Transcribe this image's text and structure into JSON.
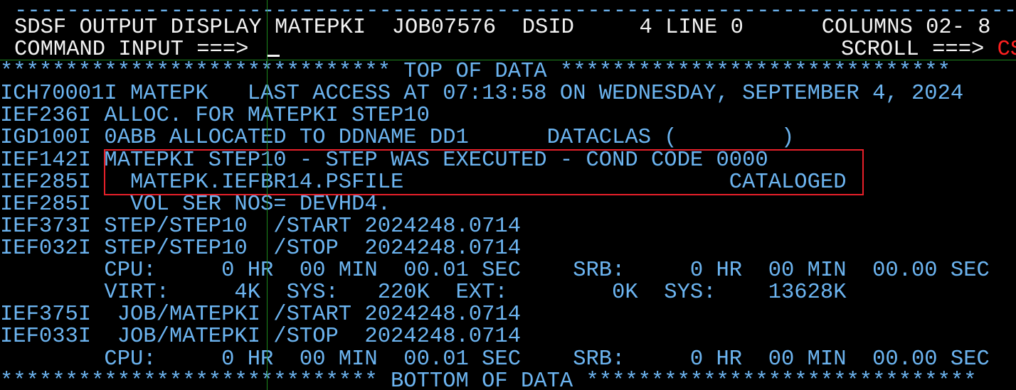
{
  "header": {
    "dashes": "-----------------------------------------------------------------------------",
    "title": "SDSF OUTPUT DISPLAY",
    "jobname": "MATEPKI",
    "jobid": "JOB07576",
    "dsid_label": "DSID",
    "dsid_value": "4",
    "line_label": "LINE",
    "line_value": "0",
    "columns_label": "COLUMNS",
    "columns_value": "02- 8",
    "command_label": "COMMAND INPUT ===>",
    "command_value": "",
    "scroll_label": "SCROLL ===>",
    "scroll_value": "CSR"
  },
  "lines": [
    {
      "text": "****************************** TOP OF DATA ******************************"
    },
    {
      "text": "ICH70001I MATEPK   LAST ACCESS AT 07:13:58 ON WEDNESDAY, SEPTEMBER 4, 2024"
    },
    {
      "text": "IEF236I ALLOC. FOR MATEPKI STEP10"
    },
    {
      "text": "IGD100I 0ABB ALLOCATED TO DDNAME DD1      DATACLAS (        )"
    },
    {
      "text": "IEF142I MATEPKI STEP10 - STEP WAS EXECUTED - COND CODE 0000"
    },
    {
      "text": "IEF285I   MATEPK.IEFBR14.PSFILE                         CATALOGED"
    },
    {
      "text": "IEF285I   VOL SER NOS= DEVHD4."
    },
    {
      "text": "IEF373I STEP/STEP10  /START 2024248.0714"
    },
    {
      "text": "IEF032I STEP/STEP10  /STOP  2024248.0714"
    },
    {
      "text": "        CPU:     0 HR  00 MIN  00.01 SEC    SRB:     0 HR  00 MIN  00.00 SEC"
    },
    {
      "text": "        VIRT:     4K  SYS:   220K  EXT:        0K  SYS:    13628K"
    },
    {
      "text": "IEF375I  JOB/MATEPKI /START 2024248.0714"
    },
    {
      "text": "IEF033I  JOB/MATEPKI /STOP  2024248.0714"
    },
    {
      "text": "        CPU:     0 HR  00 MIN  00.01 SEC    SRB:     0 HR  00 MIN  00.00 SEC"
    },
    {
      "text": "***************************** BOTTOM OF DATA ******************************"
    }
  ],
  "highlight": {
    "color": "#e8202a",
    "covers_lines": [
      4,
      5
    ]
  },
  "colors": {
    "background": "#000000",
    "output_text": "#6cb4f0",
    "header_text": "#f2f2f2",
    "scroll_value": "#ff2020",
    "crosshair": "#1e8a1e"
  }
}
